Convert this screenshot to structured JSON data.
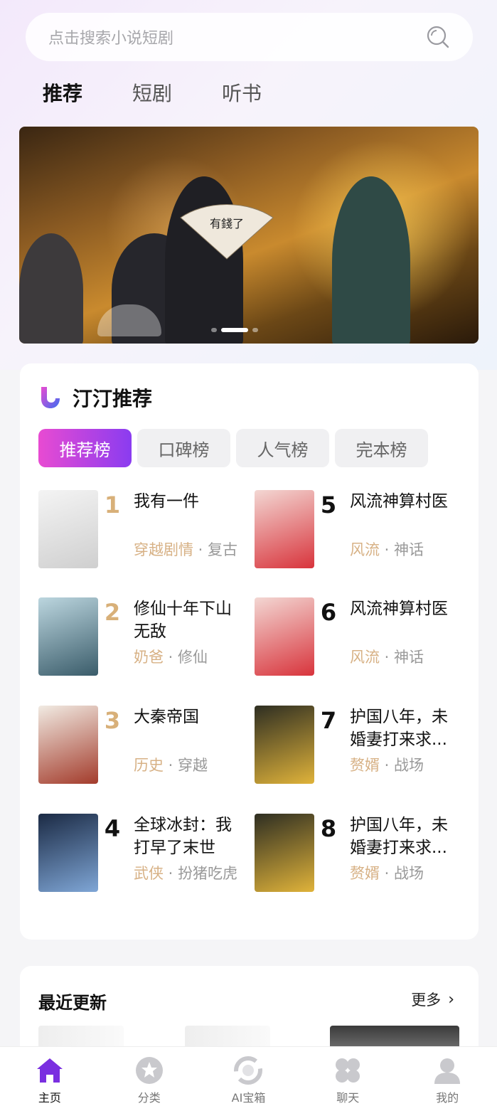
{
  "search": {
    "placeholder": "点击搜索小说短剧"
  },
  "tabs": [
    {
      "label": "推荐",
      "active": true
    },
    {
      "label": "短剧",
      "active": false
    },
    {
      "label": "听书",
      "active": false
    }
  ],
  "banner": {
    "fan_text": "有錢了",
    "slides": 3,
    "active_slide": 2
  },
  "recommend": {
    "title": "汀汀推荐",
    "rank_tabs": [
      {
        "label": "推荐榜",
        "active": true
      },
      {
        "label": "口碑榜",
        "active": false
      },
      {
        "label": "人气榜",
        "active": false
      },
      {
        "label": "完本榜",
        "active": false
      }
    ],
    "books": [
      {
        "rank": "1",
        "title": "我有一件",
        "tag1": "穿越剧情",
        "tag2": "复古",
        "cover_colors": [
          "#f4f4f4",
          "#cfcfcf"
        ]
      },
      {
        "rank": "2",
        "title": "修仙十年下山无敌",
        "tag1": "奶爸",
        "tag2": "修仙",
        "cover_colors": [
          "#bcd6df",
          "#3a5c6a"
        ]
      },
      {
        "rank": "3",
        "title": "大秦帝国",
        "tag1": "历史",
        "tag2": "穿越",
        "cover_colors": [
          "#f1ebe3",
          "#a33b2b"
        ]
      },
      {
        "rank": "4",
        "title": "全球冰封：我打早了末世",
        "tag1": "武侠",
        "tag2": "扮猪吃虎",
        "cover_colors": [
          "#1b2a44",
          "#7fa6d6"
        ]
      },
      {
        "rank": "5",
        "title": "风流神算村医",
        "tag1": "风流",
        "tag2": "神话",
        "cover_colors": [
          "#f3d7d3",
          "#d8343c"
        ]
      },
      {
        "rank": "6",
        "title": "风流神算村医",
        "tag1": "风流",
        "tag2": "神话",
        "cover_colors": [
          "#f3d7d3",
          "#d8343c"
        ]
      },
      {
        "rank": "7",
        "title": "护国八年，未婚妻打来求...",
        "tag1": "赘婿",
        "tag2": "战场",
        "cover_colors": [
          "#2e2e22",
          "#e0b33a"
        ]
      },
      {
        "rank": "8",
        "title": "护国八年，未婚妻打来求...",
        "tag1": "赘婿",
        "tag2": "战场",
        "cover_colors": [
          "#2e2e22",
          "#e0b33a"
        ]
      }
    ],
    "separator": "·"
  },
  "recent": {
    "title": "最近更新",
    "more_label": "更多",
    "chevron": "›"
  },
  "bottom_nav": [
    {
      "label": "主页",
      "icon": "home-icon",
      "active": true
    },
    {
      "label": "分类",
      "icon": "star-icon",
      "active": false
    },
    {
      "label": "AI宝箱",
      "icon": "ai-chest-icon",
      "active": false
    },
    {
      "label": "聊天",
      "icon": "chat-icon",
      "active": false
    },
    {
      "label": "我的",
      "icon": "profile-icon",
      "active": false
    }
  ],
  "colors": {
    "accent": "#7a2fe0",
    "tag": "#d7b185",
    "rank_top": "#d8b079",
    "rank_gradient": [
      "#e84bd2",
      "#8a3cf0"
    ]
  }
}
